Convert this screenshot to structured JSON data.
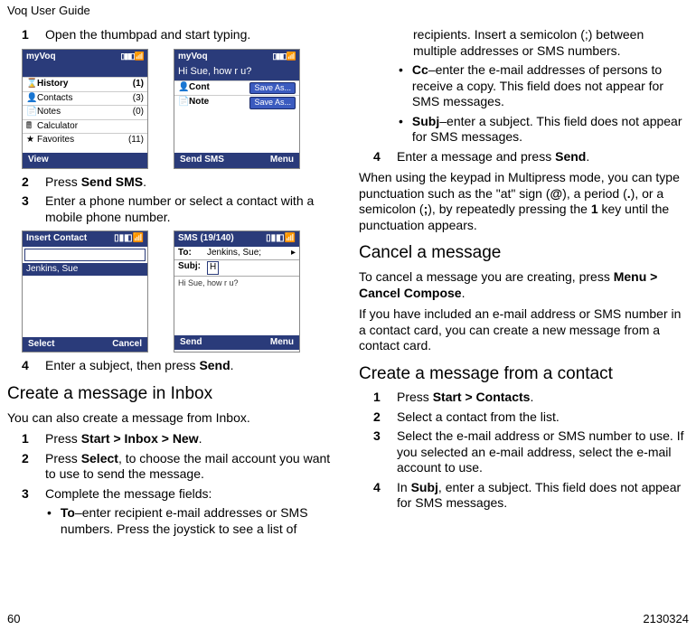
{
  "header": "Voq User Guide",
  "footer_left": "60",
  "footer_right": "2130324",
  "col1": {
    "step1": {
      "n": "1",
      "t1": "Open the thumbpad and start typing."
    },
    "phoneA": {
      "title": "myVoq",
      "rows": [
        {
          "icon": "⌛",
          "label": "History",
          "val": "(1)"
        },
        {
          "icon": "👤",
          "label": "Contacts",
          "val": "(3)"
        },
        {
          "icon": "📄",
          "label": "Notes",
          "val": "(0)"
        },
        {
          "icon": "🖩",
          "label": "Calculator",
          "val": ""
        },
        {
          "icon": "★",
          "label": "Favorites",
          "val": "(11)"
        }
      ],
      "bot_l": "View",
      "bot_r": ""
    },
    "phoneB": {
      "title": "myVoq",
      "msg": "Hi Sue, how r u?",
      "rows": [
        {
          "icon": "👤",
          "label": "Cont",
          "btn": "Save As..."
        },
        {
          "icon": "📄",
          "label": "Note",
          "btn": "Save As..."
        }
      ],
      "bot_l": "Send SMS",
      "bot_r": "Menu"
    },
    "step2": {
      "n": "2",
      "t1": "Press ",
      "b": "Send SMS",
      "t2": "."
    },
    "step3": {
      "n": "3",
      "t1": "Enter a phone number or select a contact with a mobile phone number."
    },
    "phoneC": {
      "title": "Insert Contact",
      "name": "Jenkins, Sue",
      "bot_l": "Select",
      "bot_r": "Cancel"
    },
    "phoneD": {
      "title": "SMS (19/140)",
      "to": "Jenkins, Sue;",
      "subj": "H",
      "body": "Hi Sue, how r u?",
      "bot_l": "Send",
      "bot_r": "Menu"
    },
    "step4": {
      "n": "4",
      "t1": "Enter a subject, then press ",
      "b": "Send",
      "t2": "."
    },
    "h2": "Create a message in Inbox",
    "p1": "You can also create a message from Inbox.",
    "s1": {
      "n": "1",
      "t1": "Press ",
      "b": "Start > Inbox > New",
      "t2": "."
    },
    "s2": {
      "n": "2",
      "t1": "Press ",
      "b": "Select",
      "t2": ", to choose the mail account you want to use to send the message."
    },
    "s3": {
      "n": "3",
      "t1": "Complete the message fields:"
    },
    "b_to": {
      "b": "To",
      "t": "–enter recipient e-mail addresses or SMS numbers. Press the joystick to see a list of"
    }
  },
  "col2": {
    "cont": "recipients. Insert a semicolon (;) between multiple addresses or SMS numbers.",
    "b_cc": {
      "b": "Cc",
      "t": "–enter the e-mail addresses of persons to receive a copy. This field does not appear for SMS messages."
    },
    "b_subj": {
      "b": "Subj",
      "t": "–enter a subject. This field does not appear for SMS messages."
    },
    "s4": {
      "n": "4",
      "t1": "Enter a message and press ",
      "b": "Send",
      "t2": "."
    },
    "p2a": "When using the keypad in Multipress mode, you can type punctuation such as the \"at\" sign (",
    "p2b": "), a period (",
    "p2c": "), or a semicolon (",
    "p2d": "), by repeatedly pressing the ",
    "p2e": " key until the punctuation appears.",
    "at": "@",
    "dot": ".",
    "semi": ";",
    "one": "1",
    "h3a": "Cancel a message",
    "p3a": "To cancel a message you are creating, press ",
    "p3b": "Menu > Cancel Compose",
    "p3c": ".",
    "p4": "If you have included an e-mail address or SMS number in a contact card, you can create a new message from a contact card.",
    "h3b": "Create a message from a contact",
    "c1": {
      "n": "1",
      "t1": "Press ",
      "b": "Start > Contacts",
      "t2": "."
    },
    "c2": {
      "n": "2",
      "t": "Select a contact from the list."
    },
    "c3": {
      "n": "3",
      "t": "Select the e-mail address or SMS number to use. If you selected an e-mail address, select the e-mail account to use."
    },
    "c4": {
      "n": "4",
      "t1": "In ",
      "b": "Subj",
      "t2": ", enter a subject. This field does not appear for SMS messages."
    }
  }
}
